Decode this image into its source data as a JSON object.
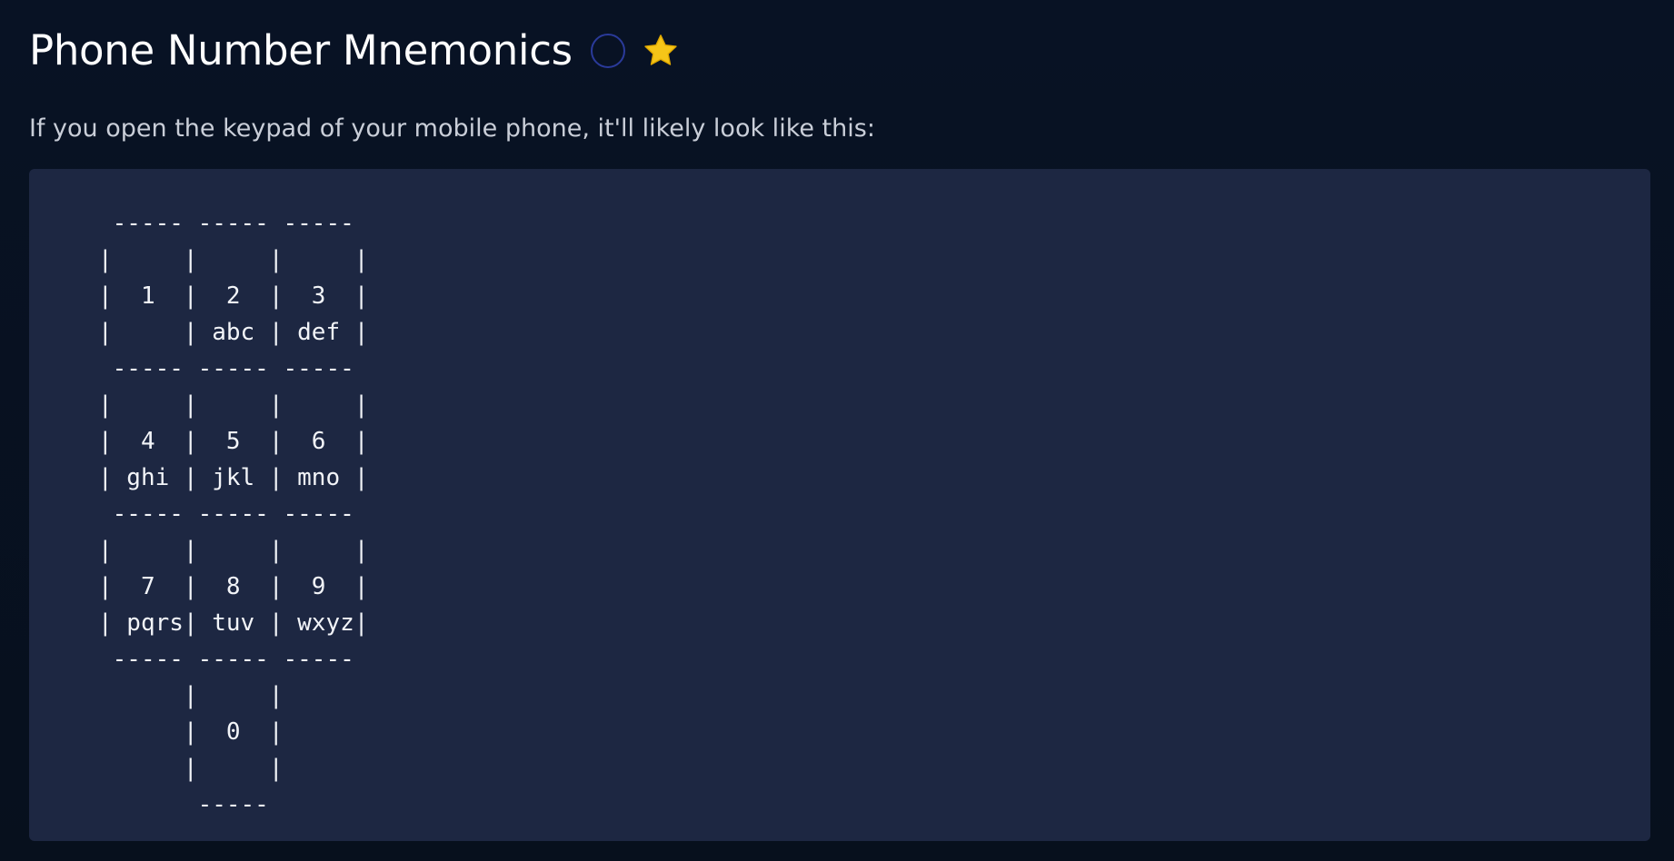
{
  "page": {
    "title": "Phone Number Mnemonics",
    "intro": "If you open the keypad of your mobile phone, it'll likely look like this:",
    "icons": {
      "status": "circle-outline-icon",
      "favorite": "star-icon"
    },
    "colors": {
      "background": "#08111f",
      "code_background": "#1d2742",
      "circle_border": "#2a3a9a",
      "star": "#f5c518"
    }
  },
  "keypad": {
    "ascii": " ----- ----- -----\n|     |     |     |\n|  1  |  2  |  3  |\n|     | abc | def |\n ----- ----- -----\n|     |     |     |\n|  4  |  5  |  6  |\n| ghi | jkl | mno |\n ----- ----- -----\n|     |     |     |\n|  7  |  8  |  9  |\n| pqrs| tuv | wxyz|\n ----- ----- -----\n      |     |\n      |  0  |\n      |     |\n       -----"
  }
}
